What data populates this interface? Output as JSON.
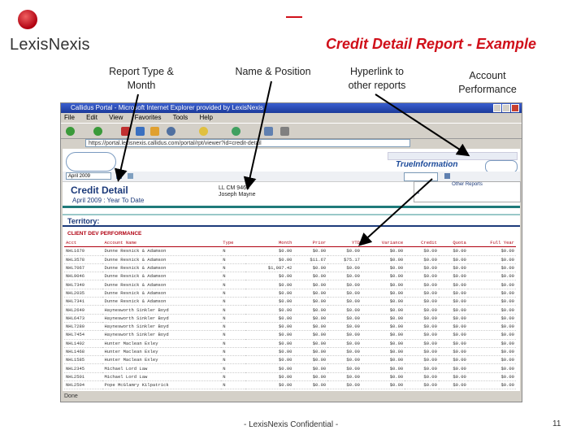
{
  "logo": {
    "text": "LexisNexis"
  },
  "slide": {
    "title": "Credit Detail Report - Example",
    "footer": "- LexisNexis Confidential -",
    "page_number": "11"
  },
  "callouts": [
    {
      "text": "Report Type & Month"
    },
    {
      "text": "Name & Position"
    },
    {
      "text": "Hyperlink to other reports"
    },
    {
      "text": "Account Performance"
    }
  ],
  "browser": {
    "title": "Callidus Portal - Microsoft Internet Explorer provided by LexisNexis",
    "menu": [
      "File",
      "Edit",
      "View",
      "Favorites",
      "Tools",
      "Help"
    ],
    "address": "https://portal.lexisnexis.callidus.com/portal/rpt/viewer?id=credit-detail",
    "status": "Done"
  },
  "report": {
    "month_select": "April 2009",
    "title": "Credit Detail",
    "subtitle": "April 2009 : Year To Date",
    "rep_id": "LL CM 9466",
    "rep_name": "Joseph Mayne",
    "brand": "TrueInformation",
    "other_reports_label": "Other Reports",
    "territory_label": "Territory:",
    "section_label": "CLIENT DEV PERFORMANCE",
    "header": [
      "Acct",
      "Account Name",
      "Type",
      "Month",
      "Prior",
      "YTD",
      "Variance",
      "Credit",
      "Quota",
      "Full Year"
    ]
  },
  "rows": [
    [
      "NHL1670",
      "Dunne Resnick & Adamson",
      "N",
      "$0.00",
      "$0.00",
      "$0.00",
      "$0.00",
      "$0.00",
      "$0.00",
      "$0.00"
    ],
    [
      "NHL3578",
      "Dunne Resnick & Adamson",
      "N",
      "$0.00",
      "$11.67",
      "$75.17",
      "$0.00",
      "$0.00",
      "$0.00",
      "$0.00"
    ],
    [
      "NHL7067",
      "Dunne Resnick & Adamson",
      "N",
      "$1,087.42",
      "$0.00",
      "$0.00",
      "$0.00",
      "$0.00",
      "$0.00",
      "$0.00"
    ],
    [
      "NHL9046",
      "Dunne Resnick & Adamson",
      "N",
      "$0.00",
      "$0.00",
      "$0.00",
      "$0.00",
      "$0.00",
      "$0.00",
      "$0.00"
    ],
    [
      "NHL7340",
      "Dunne Resnick & Adamson",
      "N",
      "$0.00",
      "$0.00",
      "$0.00",
      "$0.00",
      "$0.00",
      "$0.00",
      "$0.00"
    ],
    [
      "NHL2035",
      "Dunne Resnick & Adamson",
      "N",
      "$0.00",
      "$0.00",
      "$0.00",
      "$0.00",
      "$0.00",
      "$0.00",
      "$0.00"
    ],
    [
      "NHL7341",
      "Dunne Resnick & Adamson",
      "N",
      "$0.00",
      "$0.00",
      "$0.00",
      "$0.00",
      "$0.00",
      "$0.00",
      "$0.00"
    ],
    [
      "NHL2649",
      "Haynesworth Sinkler Boyd",
      "N",
      "$0.00",
      "$0.00",
      "$0.00",
      "$0.00",
      "$0.00",
      "$0.00",
      "$0.00"
    ],
    [
      "NHL6473",
      "Haynesworth Sinkler Boyd",
      "N",
      "$0.00",
      "$0.00",
      "$0.00",
      "$0.00",
      "$0.00",
      "$0.00",
      "$0.00"
    ],
    [
      "NHL7280",
      "Haynesworth Sinkler Boyd",
      "N",
      "$0.00",
      "$0.00",
      "$0.00",
      "$0.00",
      "$0.00",
      "$0.00",
      "$0.00"
    ],
    [
      "NHL7454",
      "Haynesworth Sinkler Boyd",
      "N",
      "$0.00",
      "$0.00",
      "$0.00",
      "$0.00",
      "$0.00",
      "$0.00",
      "$0.00"
    ],
    [
      "NHL1402",
      "Hunter Maclean Exley",
      "N",
      "$0.00",
      "$0.00",
      "$0.00",
      "$0.00",
      "$0.00",
      "$0.00",
      "$0.00"
    ],
    [
      "NHL1468",
      "Hunter Maclean Exley",
      "N",
      "$0.00",
      "$0.00",
      "$0.00",
      "$0.00",
      "$0.00",
      "$0.00",
      "$0.00"
    ],
    [
      "NHL1585",
      "Hunter Maclean Exley",
      "N",
      "$0.00",
      "$0.00",
      "$0.00",
      "$0.00",
      "$0.00",
      "$0.00",
      "$0.00"
    ],
    [
      "NHL2345",
      "Michael Lord Law",
      "N",
      "$0.00",
      "$0.00",
      "$0.00",
      "$0.00",
      "$0.00",
      "$0.00",
      "$0.00"
    ],
    [
      "NHL2501",
      "Michael Lord Law",
      "N",
      "$0.00",
      "$0.00",
      "$0.00",
      "$0.00",
      "$0.00",
      "$0.00",
      "$0.00"
    ],
    [
      "NHL2504",
      "Pope McGlamry Kilpatrick",
      "N",
      "$0.00",
      "$0.00",
      "$0.00",
      "$0.00",
      "$0.00",
      "$0.00",
      "$0.00"
    ]
  ]
}
